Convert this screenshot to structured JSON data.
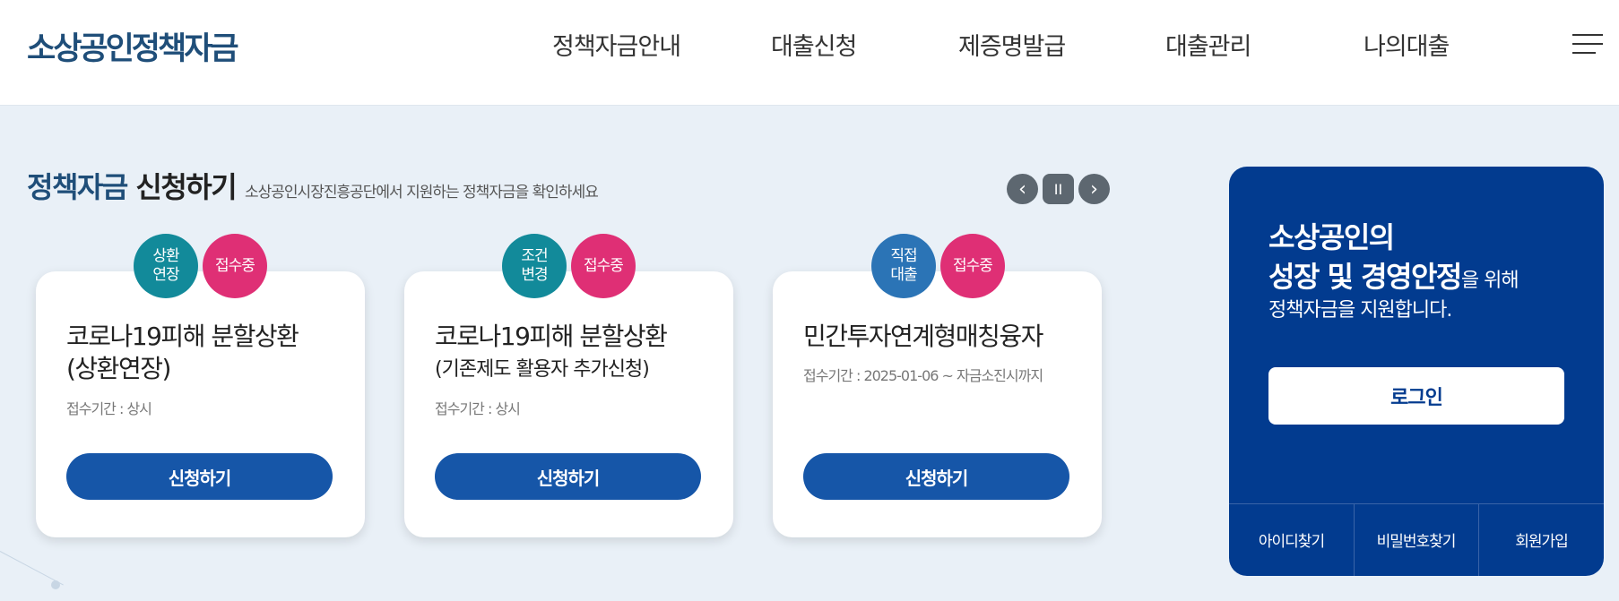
{
  "header": {
    "logo": "소상공인정책자금",
    "nav": [
      "정책자금안내",
      "대출신청",
      "제증명발급",
      "대출관리",
      "나의대출"
    ],
    "menu_icon": "hamburger-menu-icon"
  },
  "section": {
    "title_accent": "정책자금",
    "title_rest": " 신청하기",
    "subtitle": "소상공인시장진흥공단에서 지원하는 정책자금을 확인하세요",
    "controls": {
      "prev_icon": "‹",
      "pause_icon": "II",
      "next_icon": "›"
    }
  },
  "cards": [
    {
      "badges": [
        "상환\n연장",
        "접수중"
      ],
      "title": "코로나19피해 분할상환\n(상환연장)",
      "subtitle": "",
      "period": "접수기간 : 상시",
      "button": "신청하기"
    },
    {
      "badges": [
        "조건\n변경",
        "접수중"
      ],
      "title": "코로나19피해 분할상환",
      "subtitle": "(기존제도 활용자 추가신청)",
      "period": "접수기간 : 상시",
      "button": "신청하기"
    },
    {
      "badges": [
        "직접\n대출",
        "접수중"
      ],
      "title": "민간투자연계형매칭융자",
      "subtitle": "",
      "period": "접수기간 : 2025-01-06 ~ 자금소진시까지",
      "button": "신청하기"
    }
  ],
  "panel": {
    "line1": "소상공인의",
    "line2_bold": "성장 및 경영안정",
    "line2_small": "을 위해",
    "line3": "정책자금을 지원합니다.",
    "login_button": "로그인",
    "links": [
      "아이디찾기",
      "비밀번호찾기",
      "회원가입"
    ]
  },
  "colors": {
    "primary": "#1656a8",
    "panel": "#023b8f",
    "badge_teal": "#128a9a",
    "badge_pink": "#df2f75",
    "badge_blue": "#2b74b6"
  }
}
